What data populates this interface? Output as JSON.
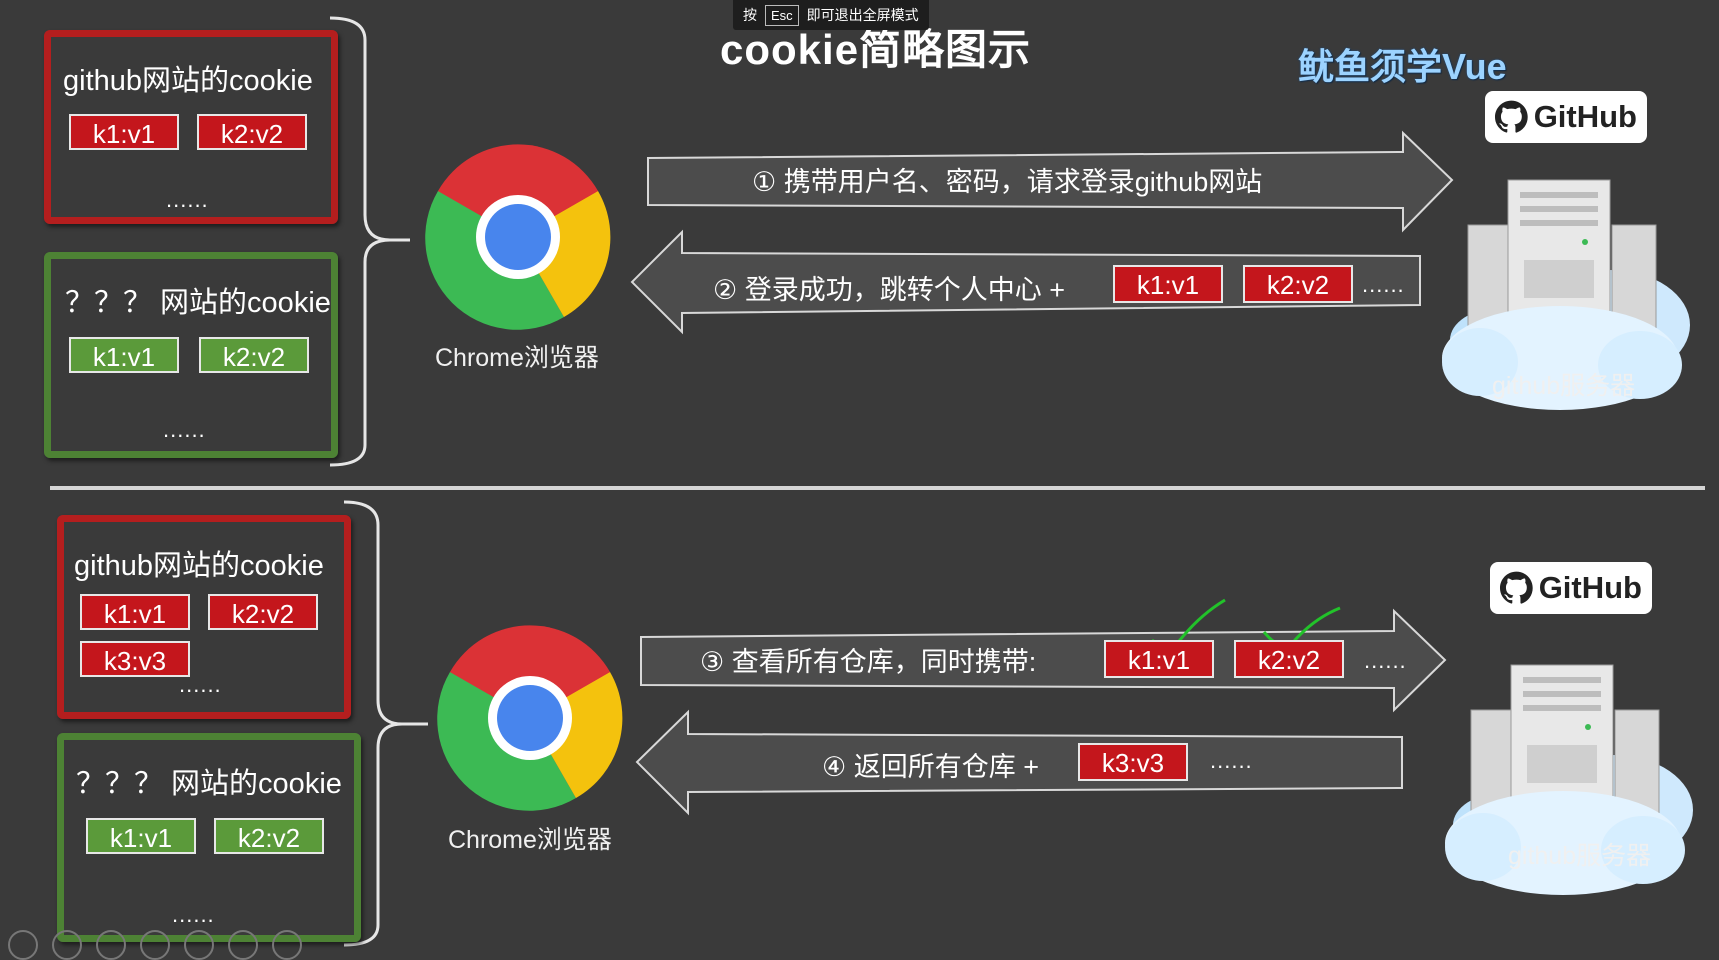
{
  "title": "cookie简略图示",
  "fullscreen_hint": {
    "prefix": "按",
    "key": "Esc",
    "suffix": "即可退出全屏模式"
  },
  "watermark": "鱿鱼须学Vue",
  "browser_label": "Chrome浏览器",
  "server_label": "github服务器",
  "github_logo_text": "GitHub",
  "ellipsis": "......",
  "top": {
    "github_box": {
      "title": "github网站的cookie",
      "chips": [
        "k1:v1",
        "k2:v2"
      ]
    },
    "other_box": {
      "title": "？？？ 网站的cookie",
      "chips": [
        "k1:v1",
        "k2:v2"
      ]
    },
    "arrow1": "① 携带用户名、密码，请求登录github网站",
    "arrow2": "② 登录成功，跳转个人中心 +",
    "arrow2_chips": [
      "k1:v1",
      "k2:v2"
    ]
  },
  "bottom": {
    "github_box": {
      "title": "github网站的cookie",
      "chips": [
        "k1:v1",
        "k2:v2",
        "k3:v3"
      ]
    },
    "other_box": {
      "title": "？？？ 网站的cookie",
      "chips": [
        "k1:v1",
        "k2:v2"
      ]
    },
    "arrow3": "③ 查看所有仓库，同时携带:",
    "arrow3_chips": [
      "k1:v1",
      "k2:v2"
    ],
    "arrow4": "④ 返回所有仓库 +",
    "arrow4_chips": [
      "k3:v3"
    ]
  },
  "colors": {
    "background": "#3a3a3a",
    "red_box": "#b41e1e",
    "green_box": "#4d8234",
    "chip_red": "#c4161c",
    "chip_green": "#5b9a3a",
    "check": "#22c22a"
  }
}
